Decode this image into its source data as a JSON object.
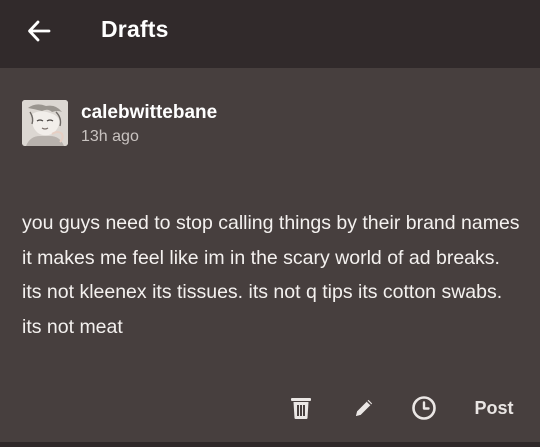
{
  "header": {
    "title": "Drafts",
    "back_icon": "arrow-left-icon"
  },
  "post": {
    "username": "calebwittebane",
    "time": "13h ago",
    "body": "you guys need to stop calling things by their brand names it makes me feel like im in the scary world of ad breaks. its not kleenex its tissues. its not q tips its cotton swabs. its not meat"
  },
  "actions": {
    "delete_icon": "trash-icon",
    "edit_icon": "pencil-icon",
    "schedule_icon": "clock-icon",
    "post_label": "Post"
  },
  "colors": {
    "topbar": "#312a2b",
    "background": "#473f3e",
    "text": "#f4f1ef",
    "muted": "#c9c3c0"
  }
}
